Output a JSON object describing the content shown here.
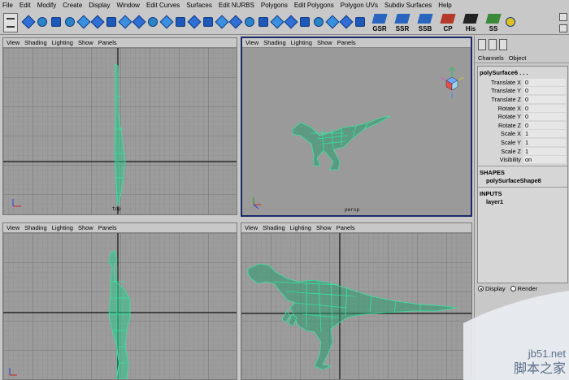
{
  "menu": [
    "File",
    "Edit",
    "Modify",
    "Create",
    "Display",
    "Window",
    "Edit Curves",
    "Surfaces",
    "Edit NURBS",
    "Polygons",
    "Edit Polygons",
    "Polygon UVs",
    "Subdiv Surfaces",
    "Help"
  ],
  "shelf": {
    "labels": [
      "GSR",
      "SSR",
      "SSB",
      "CP",
      "His",
      "SS"
    ]
  },
  "viewport_menu": [
    "View",
    "Shading",
    "Lighting",
    "Show",
    "Panels"
  ],
  "viewports": {
    "top": {
      "camera": "top"
    },
    "persp": {
      "camera": "persp"
    },
    "side": {
      "camera": ""
    },
    "front": {
      "camera": ""
    }
  },
  "channel_box": {
    "tabs": [
      "Channels",
      "Object"
    ],
    "object_name": "polySurface6 . . .",
    "attributes": [
      {
        "label": "Translate X",
        "value": "0"
      },
      {
        "label": "Translate Y",
        "value": "0"
      },
      {
        "label": "Translate Z",
        "value": "0"
      },
      {
        "label": "Rotate X",
        "value": "0"
      },
      {
        "label": "Rotate Y",
        "value": "0"
      },
      {
        "label": "Rotate Z",
        "value": "0"
      },
      {
        "label": "Scale X",
        "value": "1"
      },
      {
        "label": "Scale Y",
        "value": "1"
      },
      {
        "label": "Scale Z",
        "value": "1"
      },
      {
        "label": "Visibility",
        "value": "on"
      }
    ],
    "shapes_header": "SHAPES",
    "shape_name": "polySurfaceShape8",
    "inputs_header": "INPUTS",
    "input_name": "layer1",
    "radio_display": "Display",
    "radio_render": "Render"
  },
  "watermark": {
    "line1": "jb51.net",
    "line2": "脚本之家"
  },
  "colors": {
    "mesh": "#33e6a0",
    "grid": "#7b7b7b",
    "grid_axis": "#111111",
    "active_border": "#1b2a66"
  }
}
